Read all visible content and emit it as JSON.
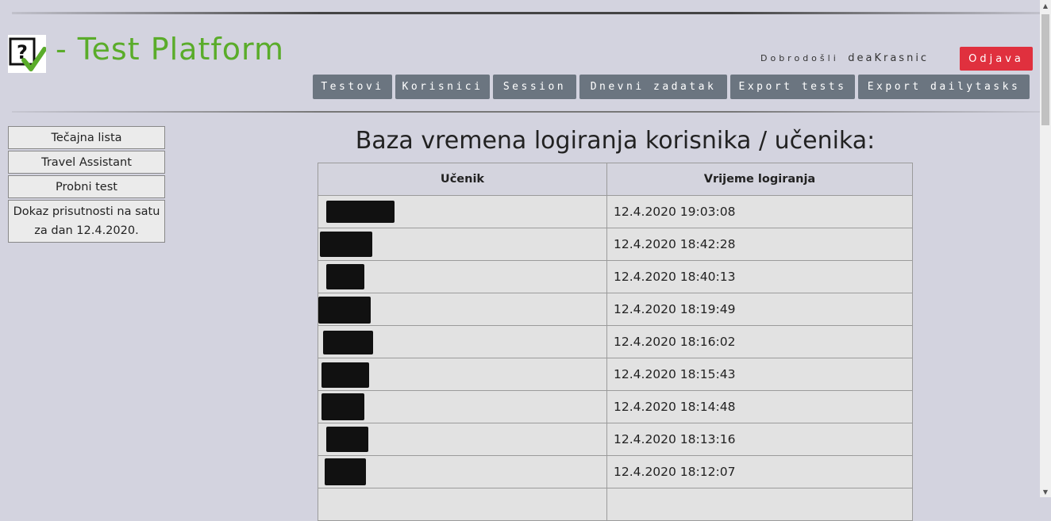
{
  "header": {
    "title": "- Test Platform",
    "logo_icon": "question-checkmark-logo",
    "welcome_label": "Dobrodošli",
    "username": "deaKrasnic",
    "logout_label": "Odjava",
    "brand_color": "#5aac2a",
    "logout_color": "#e0303e"
  },
  "nav": {
    "items": [
      {
        "label": "Testovi"
      },
      {
        "label": "Korisnici"
      },
      {
        "label": "Session"
      },
      {
        "label": "Dnevni zadatak"
      },
      {
        "label": "Export tests"
      },
      {
        "label": "Export dailytasks"
      }
    ]
  },
  "sidebar": {
    "items": [
      {
        "label": "Tečajna lista"
      },
      {
        "label": "Travel Assistant"
      },
      {
        "label": "Probni test"
      },
      {
        "label": "Dokaz prisutnosti na satu za dan 12.4.2020."
      }
    ]
  },
  "main": {
    "heading": "Baza vremena logiranja korisnika / učenika:",
    "table": {
      "columns": [
        "Učenik",
        "Vrijeme logiranja"
      ],
      "rows": [
        {
          "student": "[redacted]",
          "time": "12.4.2020 19:03:08"
        },
        {
          "student": "[redacted]",
          "time": "12.4.2020 18:42:28"
        },
        {
          "student": "[redacted]",
          "time": "12.4.2020 18:40:13"
        },
        {
          "student": "[redacted]",
          "time": "12.4.2020 18:19:49"
        },
        {
          "student": "[redacted]",
          "time": "12.4.2020 18:16:02"
        },
        {
          "student": "[redacted]",
          "time": "12.4.2020 18:15:43"
        },
        {
          "student": "[redacted]",
          "time": "12.4.2020 18:14:48"
        },
        {
          "student": "[redacted]",
          "time": "12.4.2020 18:13:16"
        },
        {
          "student": "[redacted]",
          "time": "12.4.2020 18:12:07"
        }
      ]
    }
  }
}
